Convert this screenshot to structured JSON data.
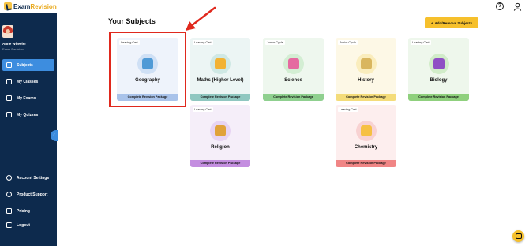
{
  "brand": {
    "name_part1": "Exam",
    "name_part2": "Revision"
  },
  "header": {
    "help_icon": "question-circle-icon",
    "user_icon": "user-icon"
  },
  "sidebar": {
    "user": {
      "name": "Anne Wheeler",
      "subtitle": "Exam Revision"
    },
    "items": [
      {
        "label": "Subjects",
        "icon": "book-icon",
        "active": true
      },
      {
        "label": "My Classes",
        "icon": "users-icon",
        "active": false
      },
      {
        "label": "My Exams",
        "icon": "file-icon",
        "active": false
      },
      {
        "label": "My Quizzes",
        "icon": "checkbox-icon",
        "active": false
      }
    ],
    "bottom_items": [
      {
        "label": "Account Settings",
        "icon": "gear-icon"
      },
      {
        "label": "Product Support",
        "icon": "help-icon"
      },
      {
        "label": "Pricing",
        "icon": "card-icon"
      },
      {
        "label": "Logout",
        "icon": "logout-icon"
      }
    ],
    "collapse_glyph": "‹"
  },
  "main": {
    "title": "Your Subjects",
    "add_button": "Add/Remove Subjects",
    "add_glyph": "+"
  },
  "subjects": [
    {
      "name": "Geography",
      "tag": "Leaving Cert",
      "footer": "Complete Revision Package",
      "bg": "#eef3fb",
      "footer_bg": "#a9c3ea",
      "circle": "#cfe0f5",
      "glyph": "#4f9ad6"
    },
    {
      "name": "Maths (Higher Level)",
      "tag": "Leaving Cert",
      "footer": "Complete Revision Package",
      "bg": "#ecf5f4",
      "footer_bg": "#8fc7c0",
      "circle": "#cfe8e4",
      "glyph": "#f2b233"
    },
    {
      "name": "Science",
      "tag": "Junior Cycle",
      "footer": "Complete Revision Package",
      "bg": "#eef7ee",
      "footer_bg": "#8fd08f",
      "circle": "#d3eed3",
      "glyph": "#e56aa0"
    },
    {
      "name": "History",
      "tag": "Junior Cycle",
      "footer": "Complete Revision Package",
      "bg": "#fdf8e6",
      "footer_bg": "#f4dc7a",
      "circle": "#faedbd",
      "glyph": "#d9b65f"
    },
    {
      "name": "Biology",
      "tag": "Leaving Cert",
      "footer": "Complete Revision Package",
      "bg": "#eef7ec",
      "footer_bg": "#8fd07d",
      "circle": "#d1ecc9",
      "glyph": "#8f4fc4"
    },
    {
      "name": "Religion",
      "tag": "Leaving Cert",
      "footer": "Complete Revision Package",
      "bg": "#f5eef9",
      "footer_bg": "#c48ee0",
      "circle": "#e7d4f3",
      "glyph": "#e0a23b"
    },
    {
      "name": "Chemistry",
      "tag": "Leaving Cert",
      "footer": "Complete Revision Package",
      "bg": "#fdeeee",
      "footer_bg": "#f08585",
      "circle": "#f8d2d2",
      "glyph": "#f6c043"
    }
  ],
  "colors": {
    "sidebar": "#0d2a4d",
    "accent": "#3d8ddf",
    "brand_yellow": "#f6c02c",
    "highlight": "#e0281d"
  }
}
